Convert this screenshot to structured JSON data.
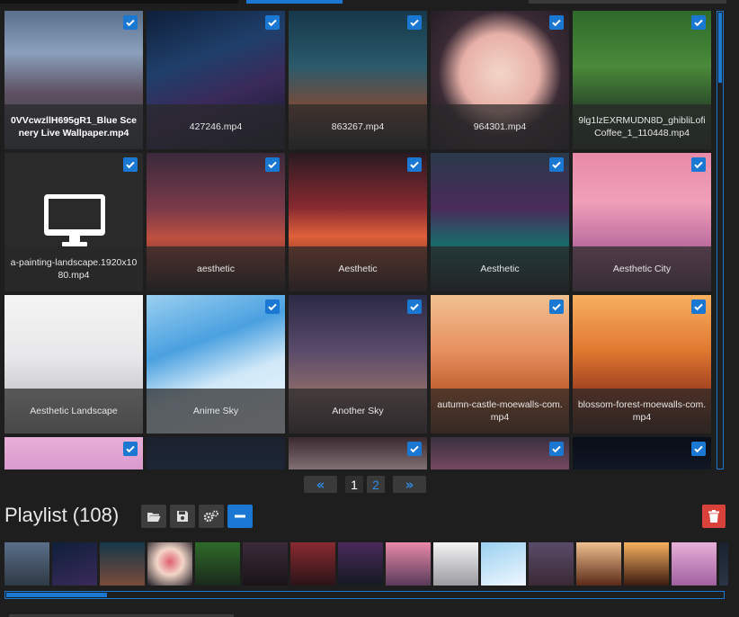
{
  "colors": {
    "accent": "#1a78d2",
    "background": "#1e1e1e",
    "danger": "#d9423a"
  },
  "grid": {
    "tiles": [
      {
        "label": "0VVcwzllH695gR1_Blue Scenery Live Wallpaper.mp4",
        "checked": true,
        "selected": true,
        "bg": "linear-gradient(180deg,#5a6f8a 0%,#8aa0bd 30%,#5d5060 60%,#2f3a46 100%)"
      },
      {
        "label": "427246.mp4",
        "checked": true,
        "bg": "linear-gradient(160deg,#0e1f3a 0%,#1f3f6a 35%,#3a2a5a 60%,#101828 100%)"
      },
      {
        "label": "863267.mp4",
        "checked": true,
        "bg": "linear-gradient(180deg,#16384a 0%,#2a5a6a 40%,#7a4a3a 70%,#1a2228 100%)"
      },
      {
        "label": "964301.mp4",
        "checked": true,
        "bg": "radial-gradient(circle at 50% 45%,#f3d6c8 0%,#e7b0a8 38%,#3a2a34 60%,#1e1a22 100%)"
      },
      {
        "label": "9lg1lzEXRMUDN8D_ghibliLofiCoffee_1_110448.mp4",
        "checked": true,
        "bg": "linear-gradient(180deg,#2f6a2a 0%,#4a8a3a 40%,#2a4a2a 70%,#1a2a1a 100%)"
      },
      {
        "label": "a-painting-landscape.1920x1080.mp4",
        "checked": true,
        "icon": "monitor-icon",
        "bg": "#2a2a2a"
      },
      {
        "label": "aesthetic",
        "checked": true,
        "bg": "linear-gradient(180deg,#3a2a3a 0%,#7a3a4a 40%,#c05040 62%,#1a1418 100%)"
      },
      {
        "label": "Aesthetic",
        "checked": true,
        "bg": "linear-gradient(180deg,#2a1a22 0%,#8a2a30 40%,#e0603a 60%,#2a1418 100%)"
      },
      {
        "label": "Aesthetic",
        "checked": true,
        "bg": "linear-gradient(180deg,#2a3a4a 0%,#4a2a5a 40%,#1a6a6a 65%,#141a22 100%)"
      },
      {
        "label": "Aesthetic City",
        "checked": true,
        "bg": "linear-gradient(180deg,#e88aa8 0%,#f0a0b8 35%,#c070a0 65%,#5a3a5a 100%)"
      },
      {
        "label": "Aesthetic Landscape",
        "checked": false,
        "bg": "linear-gradient(180deg,#f4f4f4 0%,#e8e8ea 45%,#c8c8cc 75%,#9a9aa0 100%)"
      },
      {
        "label": "Anime Sky",
        "checked": true,
        "bg": "linear-gradient(160deg,#9ad0f0 0%,#4aa0e0 35%,#d0e8f8 60%,#f0f8ff 100%)"
      },
      {
        "label": "Another Sky",
        "checked": true,
        "bg": "linear-gradient(180deg,#2a2a44 0%,#5a4a6a 40%,#8a6a6a 70%,#3a2a34 100%)"
      },
      {
        "label": "autumn-castle-moewalls-com.mp4",
        "checked": true,
        "bg": "linear-gradient(180deg,#f0c090 0%,#e89060 40%,#c06030 70%,#5a2a18 100%)"
      },
      {
        "label": "blossom-forest-moewalls-com.mp4",
        "checked": true,
        "bg": "linear-gradient(180deg,#f8b060 0%,#e07830 40%,#a04020 70%,#3a1a10 100%)"
      },
      {
        "label": "",
        "checked": true,
        "bg": "linear-gradient(180deg,#e8b0d8 0%,#c880c0 50%,#a060a0 100%)"
      },
      {
        "label": "",
        "checked": false,
        "bg": "linear-gradient(180deg,#1a2230 0%,#2a3444 100%)"
      },
      {
        "label": "",
        "checked": true,
        "bg": "linear-gradient(180deg,#3a2a30 0%,#f0e0e0 60%,#e0a0a0 100%)"
      },
      {
        "label": "",
        "checked": true,
        "bg": "linear-gradient(180deg,#3a3040 0%,#d07090 60%,#f0a0c0 100%)"
      },
      {
        "label": "",
        "checked": true,
        "bg": "linear-gradient(180deg,#0a0e18 0%,#1a2434 60%,#2a3a4a 100%)"
      }
    ]
  },
  "pagination": {
    "prev_label": "«",
    "next_label": "»",
    "pages": [
      "1",
      "2"
    ],
    "current_page": 1
  },
  "playlist": {
    "title": "Playlist (108)",
    "toolbar": [
      {
        "icon": "folder-open-icon"
      },
      {
        "icon": "save-icon"
      },
      {
        "icon": "settings-icon"
      },
      {
        "icon": "minus-icon",
        "active": true
      }
    ],
    "delete_icon": "trash-icon",
    "thumbnails": [
      "linear-gradient(180deg,#5a6f8a,#2f3a46)",
      "linear-gradient(160deg,#0e1f3a,#3a2a5a)",
      "linear-gradient(180deg,#16384a,#7a4a3a)",
      "radial-gradient(circle at 50% 45%,#e06070 0%,#f3d6c8 40%,#1e1a22 100%)",
      "linear-gradient(180deg,#2f6a2a,#1a2a1a)",
      "linear-gradient(180deg,#3a2a3a,#1a1418)",
      "linear-gradient(180deg,#8a2a30,#2a1418)",
      "linear-gradient(180deg,#4a2a5a,#141a22)",
      "linear-gradient(180deg,#e88aa8,#5a3a5a)",
      "linear-gradient(180deg,#f4f4f4,#9a9aa0)",
      "linear-gradient(160deg,#9ad0f0,#f0f8ff)",
      "linear-gradient(180deg,#5a4a6a,#3a2a34)",
      "linear-gradient(180deg,#f0c090,#5a2a18)",
      "linear-gradient(180deg,#f8b060,#3a1a10)",
      "linear-gradient(180deg,#e8b0d8,#a060a0)",
      "linear-gradient(180deg,#1a2230,#2a3444)"
    ],
    "scroll_position": 0.14
  }
}
